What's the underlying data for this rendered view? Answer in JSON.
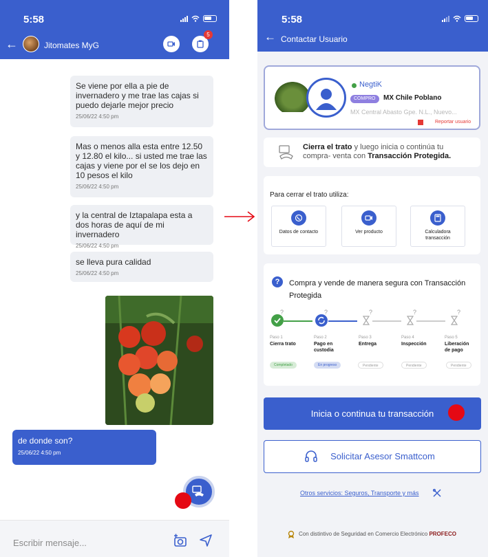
{
  "left": {
    "status_time": "5:58",
    "chat_title": "Jitomates MyG",
    "notif_count": "5",
    "messages": [
      {
        "text": "Se viene por ella a pie de invernadero y me trae las cajas si puedo dejarle mejor precio",
        "time": "25/06/22 4:50 pm"
      },
      {
        "text": "Mas o menos alla esta entre 12.50 y 12.80 el kilo... si usted me trae las cajas y viene por el se los dejo en 10 pesos el kilo",
        "time": "25/06/22 4:50 pm"
      },
      {
        "text": "y la central de Iztapalapa esta a dos horas de aquí de mi invernadero",
        "time": "25/06/22 4:50 pm"
      },
      {
        "text": "se lleva pura calidad",
        "time": "25/06/22 4:50 pm"
      }
    ],
    "outgoing": {
      "text": "de donde son?",
      "time": "25/06/22 4:50 pm"
    },
    "input_placeholder": "Escribir mensaje..."
  },
  "right": {
    "status_time": "5:58",
    "title": "Contactar Usuario",
    "seller": {
      "name": "NegtiK",
      "tag": "COMPRO",
      "product": "MX Chile Poblano",
      "location": "MX Central Abasto Gpe. N.L., Nuevo...",
      "report": "Reportar usuario"
    },
    "deal": {
      "bold1": "Cierra el trato",
      "text1": " y luego inicia o continúa tu compra- venta con ",
      "bold2": "Transacción Protegida."
    },
    "tools": {
      "title": "Para cerrar el trato utiliza:",
      "items": [
        "Datos de contacto",
        "Ver producto",
        "Calculadora transacción"
      ]
    },
    "steps": {
      "title": "Compra y vende de manera segura con Transacción Protegida",
      "items": [
        {
          "num": "Paso 1",
          "name": "Cierra trato",
          "status": "Completado"
        },
        {
          "num": "Paso 2",
          "name": "Pago en custodia",
          "status": "En progreso"
        },
        {
          "num": "Paso 3",
          "name": "Entrega",
          "status": "Pendiente"
        },
        {
          "num": "Paso 4",
          "name": "Inspección",
          "status": "Pendiente"
        },
        {
          "num": "Paso 5",
          "name": "Liberación de pago",
          "status": "Pendiente"
        }
      ]
    },
    "primary_button": "Inicia o continua tu transacción",
    "advisor_button": "Solicitar Asesor Smattcom",
    "other_services": "Otros servicios: Seguros, Transporte y más",
    "footer_text": "Con distintivo de Seguridad en Comercio Electrónico ",
    "footer_brand": "PROFECO"
  },
  "colors": {
    "primary": "#3a5fcd",
    "annotation_red": "#e50914",
    "success": "#43a047"
  }
}
